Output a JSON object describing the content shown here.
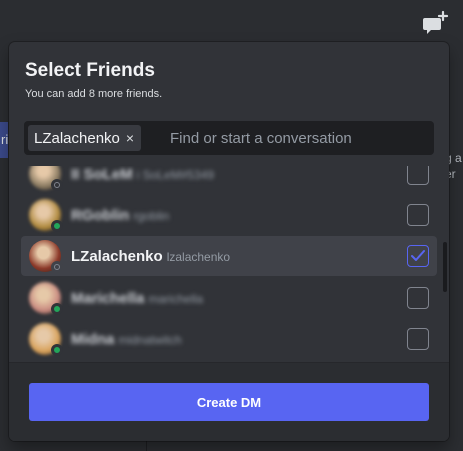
{
  "background": {
    "left_fragment": "ri",
    "right_fragment": "g a\ner"
  },
  "popout": {
    "title": "Select Friends",
    "subtitle": "You can add 8 more friends.",
    "search": {
      "chip_label": "LZalachenko",
      "chip_remove": "×",
      "placeholder": "Find or start a conversation"
    },
    "friends": [
      {
        "name": "II SoLeM",
        "username": "i SoLeM#5349",
        "status": "offline",
        "checked": false,
        "obscured": true,
        "avatar_color": "#8a7b62"
      },
      {
        "name": "RGoblin",
        "username": "rgoblin",
        "status": "online",
        "checked": false,
        "obscured": true,
        "avatar_color": "#b08a3e"
      },
      {
        "name": "LZalachenko",
        "username": "lzalachenko",
        "status": "offline",
        "checked": true,
        "obscured": false,
        "avatar_color": "#8c3a2a"
      },
      {
        "name": "Marichella",
        "username": "marichella",
        "status": "online",
        "checked": false,
        "obscured": true,
        "avatar_color": "#c98a80"
      },
      {
        "name": "Midna",
        "username": "midnatwitch",
        "status": "online",
        "checked": false,
        "obscured": true,
        "avatar_color": "#d9a25a"
      }
    ],
    "create_button": "Create DM"
  },
  "colors": {
    "brand": "#5865f2",
    "online": "#23a55a",
    "offline": "#80848e"
  }
}
